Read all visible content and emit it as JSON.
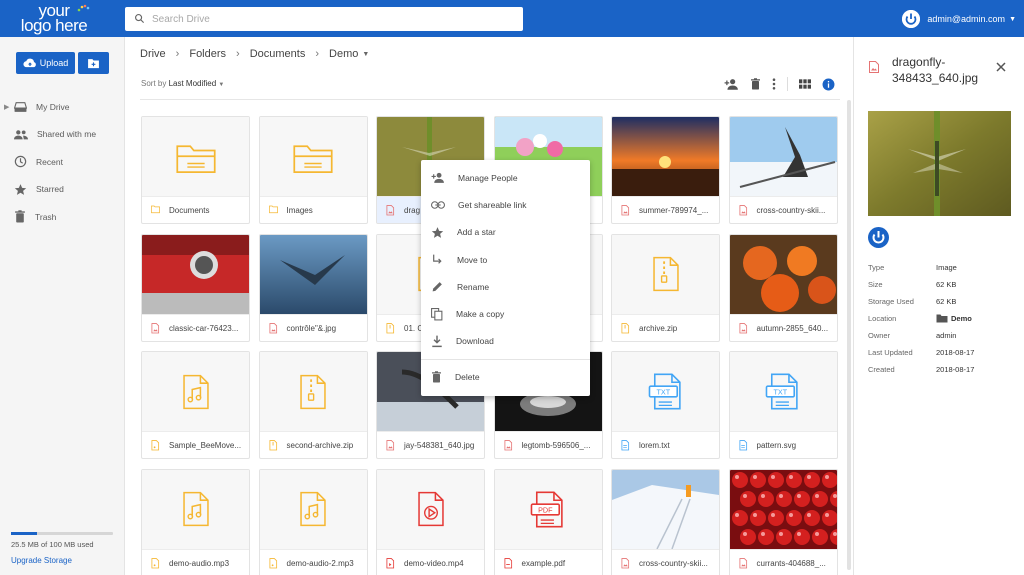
{
  "header": {
    "logo_line1": "your",
    "logo_line2": "logo here",
    "search_placeholder": "Search Drive",
    "search_value": "",
    "account_email": "admin@admin.com",
    "brand_color": "#1a63c6"
  },
  "sidebar": {
    "upload_label": "Upload",
    "items": [
      {
        "label": "My Drive",
        "icon": "drive-icon"
      },
      {
        "label": "Shared with me",
        "icon": "people-icon"
      },
      {
        "label": "Recent",
        "icon": "clock-icon"
      },
      {
        "label": "Starred",
        "icon": "star-icon"
      },
      {
        "label": "Trash",
        "icon": "trash-icon"
      }
    ],
    "storage_text": "25.5 MB of 100 MB used",
    "storage_used_fraction": 0.255,
    "upgrade_label": "Upgrade Storage"
  },
  "breadcrumb": [
    "Drive",
    "Folders",
    "Documents",
    "Demo"
  ],
  "sort": {
    "prefix": "Sort by",
    "value": "Last Modified"
  },
  "files": [
    {
      "name": "Documents",
      "kind": "folder"
    },
    {
      "name": "Images",
      "kind": "folder"
    },
    {
      "name": "dragonfly-348433_640.jpg",
      "shown": "drag",
      "kind": "image"
    },
    {
      "name": "",
      "kind": "image"
    },
    {
      "name": "summer-789974_...",
      "kind": "image"
    },
    {
      "name": "cross-country-skii...",
      "kind": "image"
    },
    {
      "name": "classic-car-76423...",
      "kind": "image"
    },
    {
      "name": "contrôle\"&.jpg",
      "kind": "image"
    },
    {
      "name": "01. C",
      "kind": "archive"
    },
    {
      "name": "",
      "kind": "archive"
    },
    {
      "name": "archive.zip",
      "kind": "archive"
    },
    {
      "name": "autumn-2855_640...",
      "kind": "image"
    },
    {
      "name": "Sample_BeeMove...",
      "kind": "audio"
    },
    {
      "name": "second-archive.zip",
      "kind": "archive"
    },
    {
      "name": "jay-548381_640.jpg",
      "kind": "image"
    },
    {
      "name": "legtomb-596506_...",
      "kind": "image"
    },
    {
      "name": "lorem.txt",
      "kind": "text"
    },
    {
      "name": "pattern.svg",
      "kind": "text"
    },
    {
      "name": "demo-audio.mp3",
      "kind": "audio"
    },
    {
      "name": "demo-audio-2.mp3",
      "kind": "audio"
    },
    {
      "name": "demo-video.mp4",
      "kind": "video"
    },
    {
      "name": "example.pdf",
      "kind": "pdf"
    },
    {
      "name": "cross-country-skii...",
      "kind": "image"
    },
    {
      "name": "currants-404688_...",
      "kind": "image"
    }
  ],
  "context_menu": {
    "items": [
      {
        "label": "Manage People",
        "icon": "person-add-icon"
      },
      {
        "label": "Get shareable link",
        "icon": "link-icon"
      },
      {
        "label": "Add a star",
        "icon": "star-icon"
      },
      {
        "label": "Move to",
        "icon": "move-icon"
      },
      {
        "label": "Rename",
        "icon": "pencil-icon"
      },
      {
        "label": "Make a copy",
        "icon": "copy-icon"
      },
      {
        "label": "Download",
        "icon": "download-icon"
      }
    ],
    "delete_label": "Delete"
  },
  "details": {
    "title": "dragonfly-348433_640.jpg",
    "properties": [
      {
        "key": "Type",
        "value": "Image"
      },
      {
        "key": "Size",
        "value": "62 KB"
      },
      {
        "key": "Storage Used",
        "value": "62 KB"
      },
      {
        "key": "Location",
        "value": "Demo"
      },
      {
        "key": "Owner",
        "value": "admin"
      },
      {
        "key": "Last Updated",
        "value": "2018-08-17"
      },
      {
        "key": "Created",
        "value": "2018-08-17"
      }
    ]
  }
}
